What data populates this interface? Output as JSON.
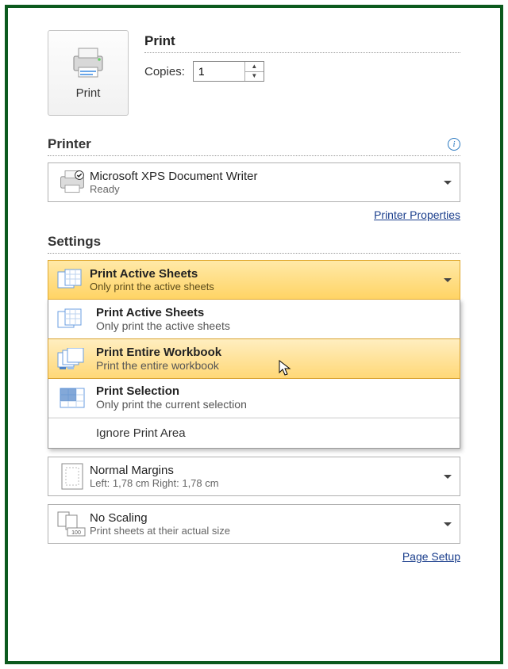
{
  "print_button": {
    "label": "Print"
  },
  "print_section": {
    "title": "Print",
    "copies_label": "Copies:",
    "copies_value": "1"
  },
  "printer_section": {
    "title": "Printer",
    "selected": {
      "name": "Microsoft XPS Document Writer",
      "status": "Ready"
    },
    "properties_link": "Printer Properties"
  },
  "settings_section": {
    "title": "Settings",
    "what_to_print": {
      "selected": {
        "title": "Print Active Sheets",
        "sub": "Only print the active sheets"
      },
      "options": [
        {
          "title": "Print Active Sheets",
          "sub": "Only print the active sheets",
          "hover": false
        },
        {
          "title": "Print Entire Workbook",
          "sub": "Print the entire workbook",
          "hover": true
        },
        {
          "title": "Print Selection",
          "sub": "Only print the current selection",
          "hover": false
        }
      ],
      "ignore_label": "Ignore Print Area"
    },
    "margins": {
      "title": "Normal Margins",
      "sub": "Left: 1,78 cm   Right: 1,78 cm"
    },
    "scaling": {
      "title": "No Scaling",
      "sub": "Print sheets at their actual size"
    },
    "page_setup_link": "Page Setup"
  }
}
